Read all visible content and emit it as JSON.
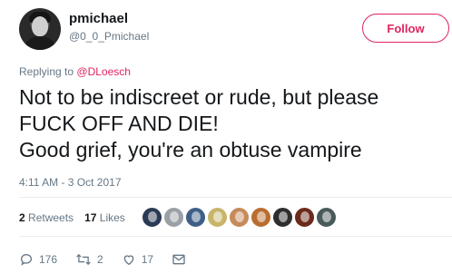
{
  "author": {
    "name": "pmichael",
    "handle": "@0_0_Pmichael"
  },
  "follow_button": {
    "label": "Follow"
  },
  "reply_context": {
    "prefix": "Replying to",
    "mention": "@DLoesch"
  },
  "tweet": {
    "text": "Not to be indiscreet or rude, but please\nFUCK OFF AND DIE!\nGood grief, you're an obtuse vampire",
    "timestamp": "4:11 AM - 3 Oct 2017"
  },
  "stats": {
    "retweets_count": "2",
    "retweets_label": "Retweets",
    "likes_count": "17",
    "likes_label": "Likes"
  },
  "liker_avatars": [
    {
      "icon": "liker-avatar-icon",
      "color": "#2b3a55"
    },
    {
      "icon": "liker-avatar-icon",
      "color": "#9aa0a6"
    },
    {
      "icon": "liker-avatar-icon",
      "color": "#3f5f86"
    },
    {
      "icon": "liker-avatar-icon",
      "color": "#c8b56b"
    },
    {
      "icon": "liker-avatar-icon",
      "color": "#c58b5b"
    },
    {
      "icon": "liker-avatar-icon",
      "color": "#b96d2f"
    },
    {
      "icon": "liker-avatar-icon",
      "color": "#2e2e2e"
    },
    {
      "icon": "liker-avatar-icon",
      "color": "#6b2a1c"
    },
    {
      "icon": "liker-avatar-icon",
      "color": "#4a5a5a"
    }
  ],
  "actions": {
    "reply_count": "176",
    "retweet_count": "2",
    "like_count": "17"
  },
  "colors": {
    "accent": "#e0245e",
    "secondary_text": "#657786",
    "primary_text": "#14171a"
  }
}
